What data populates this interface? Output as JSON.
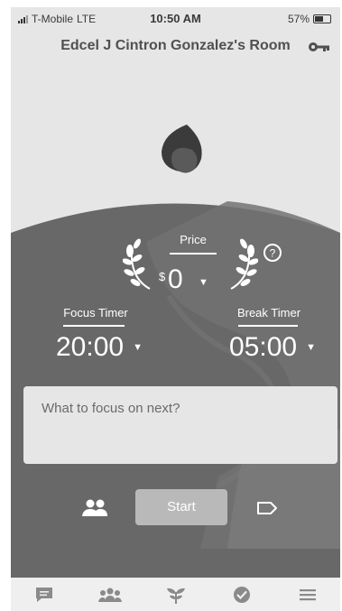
{
  "status_bar": {
    "carrier": "T-Mobile",
    "network": "LTE",
    "time": "10:50 AM",
    "battery": "57%"
  },
  "header": {
    "title": "Edcel J Cintron Gonzalez's Room",
    "key_icon": "key-icon"
  },
  "price": {
    "label": "Price",
    "currency": "$",
    "value": "0"
  },
  "timers": {
    "focus": {
      "label": "Focus Timer",
      "value": "20:00"
    },
    "break": {
      "label": "Break Timer",
      "value": "05:00"
    }
  },
  "focus_input": {
    "placeholder": "What to focus on next?"
  },
  "actions": {
    "start_label": "Start"
  },
  "tabbar": {
    "items": [
      "chat-icon",
      "group-icon",
      "plant-icon",
      "check-circle-icon",
      "menu-icon"
    ]
  },
  "colors": {
    "background": "#e6e6e6",
    "dark_region": "#6b6b6b",
    "start_button": "#b9b9b9"
  }
}
